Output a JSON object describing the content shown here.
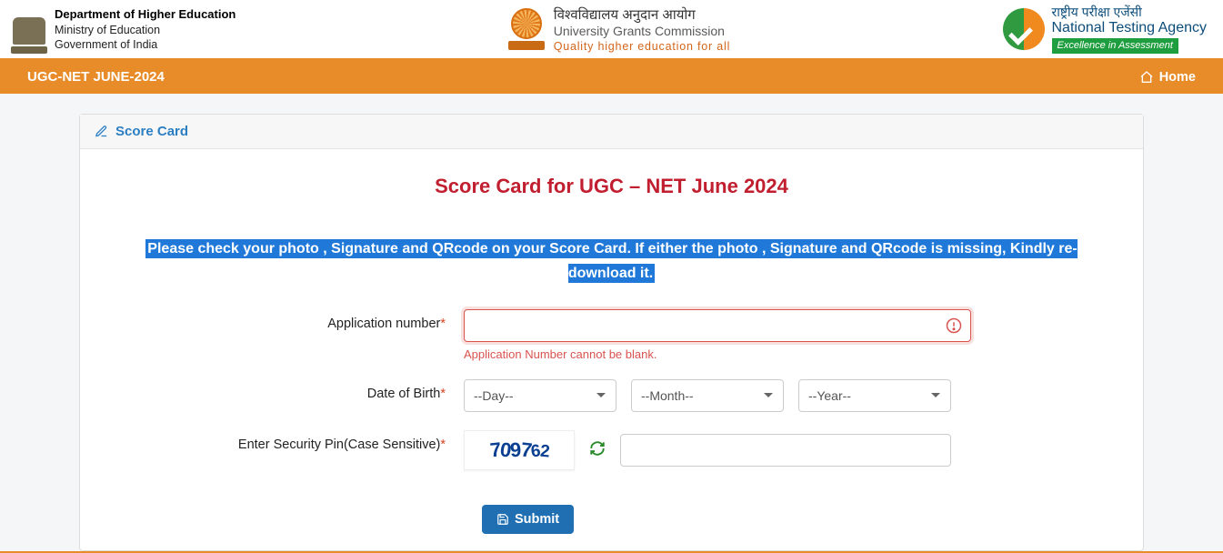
{
  "header": {
    "left": {
      "line1": "Department of Higher Education",
      "line2": "Ministry of Education",
      "line3": "Government of India"
    },
    "center": {
      "hindi": "विश्वविद्यालय अनुदान आयोग",
      "english": "University Grants Commission",
      "tagline": "Quality higher education for all"
    },
    "right": {
      "hindi": "राष्ट्रीय परीक्षा एजेंसी",
      "english": "National Testing Agency",
      "tagline": "Excellence in Assessment"
    }
  },
  "navbar": {
    "title": "UGC-NET JUNE-2024",
    "home": "Home"
  },
  "card": {
    "breadcrumb": "Score Card",
    "title": "Score Card for UGC – NET June 2024",
    "notice": "Please check your photo , Signature and QRcode on your Score Card. If either the photo , Signature and QRcode is missing, Kindly re-download it."
  },
  "form": {
    "app_label": "Application number",
    "app_value": "",
    "app_error": "Application Number cannot be blank.",
    "dob_label": "Date of Birth",
    "day_placeholder": "--Day--",
    "month_placeholder": "--Month--",
    "year_placeholder": "--Year--",
    "pin_label": "Enter Security Pin(Case Sensitive)",
    "captcha": "709762",
    "pin_value": "",
    "submit": "Submit"
  }
}
